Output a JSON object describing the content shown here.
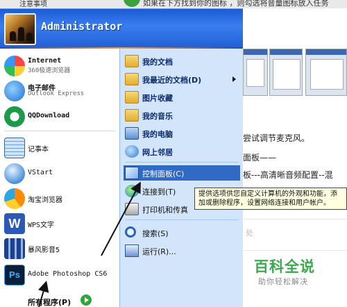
{
  "background": {
    "top_left": "注意事项",
    "top_line": "如果在下方找到你的图标 ，则勾选将音量图标放入任务",
    "lines": [
      "尝试调节麦克风。",
      "面板——",
      "板---高清晰音频配置--混",
      "处"
    ],
    "watermark": {
      "title": "百科全说",
      "subtitle": "助你轻松解决"
    }
  },
  "start_menu": {
    "user": {
      "name": "Administrator"
    },
    "left_items": [
      {
        "title": "Internet",
        "subtitle": "360极速浏览器"
      },
      {
        "title": "电子邮件",
        "subtitle": "Outlook Express"
      },
      {
        "title": "QQDownload"
      },
      {
        "title": "记事本"
      },
      {
        "title": "VStart"
      },
      {
        "title": "淘宝浏览器"
      },
      {
        "title": "WPS文字"
      },
      {
        "title": "暴风影音5"
      },
      {
        "title": "Adobe Photoshop CS6"
      }
    ],
    "all_programs": "所有程序(P)",
    "right_items": [
      {
        "label": "我的文档"
      },
      {
        "label": "我最近的文档(D)"
      },
      {
        "label": "图片收藏"
      },
      {
        "label": "我的音乐"
      },
      {
        "label": "我的电脑"
      },
      {
        "label": "网上邻居"
      },
      {
        "label": "控制面板(C)"
      },
      {
        "label": "连接到(T)"
      },
      {
        "label": "打印机和传真"
      },
      {
        "label": "搜索(S)"
      },
      {
        "label": "运行(R)..."
      }
    ],
    "tooltip": "提供选项供您自定义计算机的外观和功能，添加或删除程序，设置网络连接和用户帐户。"
  },
  "colors": {
    "header_blue": "#2a6ae2",
    "right_pane": "#d3e5fa",
    "selection": "#316ac5",
    "tooltip_bg": "#ffffe1",
    "watermark_green": "#3aaa4c"
  }
}
